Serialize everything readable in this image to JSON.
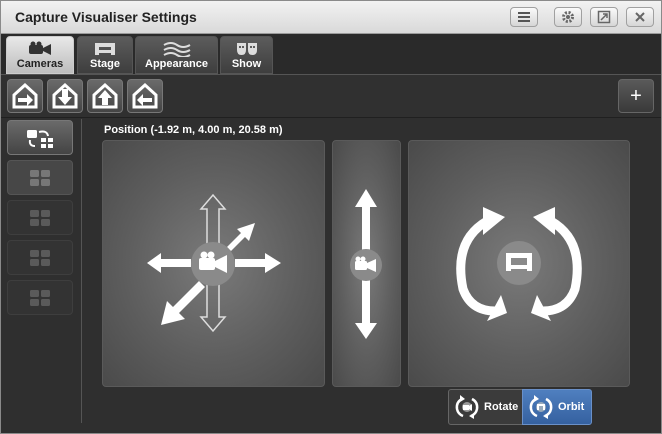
{
  "window": {
    "title": "Capture Visualiser Settings"
  },
  "titlebar_icons": [
    "menu-icon",
    "gear-icon",
    "restore-icon",
    "close-icon"
  ],
  "tabs": [
    {
      "label": "Cameras",
      "icon": "camera-icon",
      "active": true
    },
    {
      "label": "Stage",
      "icon": "stage-icon",
      "active": false
    },
    {
      "label": "Appearance",
      "icon": "waves-icon",
      "active": false
    },
    {
      "label": "Show",
      "icon": "theatre-masks-icon",
      "active": false
    }
  ],
  "toolbar": {
    "buttons": [
      "house-arrow-right-icon",
      "house-arrow-down-icon",
      "house-arrow-up-icon",
      "house-arrow-left-icon"
    ],
    "add_label": "+"
  },
  "sidebar": {
    "slots": 5,
    "selected": 1
  },
  "position": {
    "label": "Position (-1.92 m, 4.00 m, 20.58 m)"
  },
  "modes": {
    "rotate_label": "Rotate",
    "orbit_label": "Orbit",
    "active": "orbit"
  },
  "colors": {
    "accent": "#3f6fb0",
    "panel": "#6a6a6a",
    "background": "#2f2f2f"
  }
}
